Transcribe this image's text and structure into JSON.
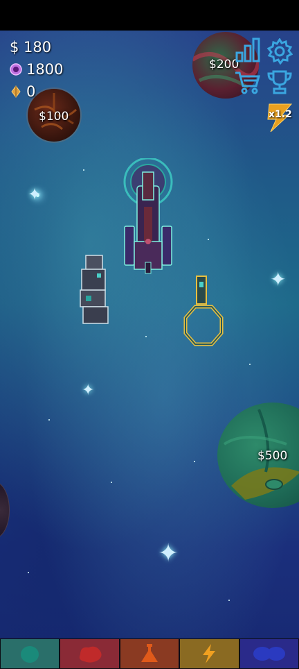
{
  "hud": {
    "money": "$ 180",
    "orbs": "1800",
    "crystals": "0"
  },
  "planets": [
    {
      "id": "planet-left",
      "price": "$100"
    },
    {
      "id": "planet-top-right",
      "price": "$200"
    },
    {
      "id": "planet-bottom-right",
      "price": "$500"
    }
  ],
  "multiplier": "x1.2",
  "icons": {
    "stats": "bar-chart-icon",
    "settings": "gear-icon",
    "shop": "shopping-cart-icon",
    "trophy": "trophy-icon",
    "multiplier": "lightning-bolt-icon"
  },
  "tabs": [
    {
      "name": "tab-ships",
      "color": "#2a6f6a",
      "icon": "orb-icon"
    },
    {
      "name": "tab-weapons",
      "color": "#8a2a36",
      "icon": "blob-icon"
    },
    {
      "name": "tab-research",
      "color": "#8a3a22",
      "icon": "flask-icon"
    },
    {
      "name": "tab-energy",
      "color": "#8a6a22",
      "icon": "lightning-icon"
    },
    {
      "name": "tab-fleet",
      "color": "#2a2a8a",
      "icon": "infinity-icon"
    }
  ]
}
